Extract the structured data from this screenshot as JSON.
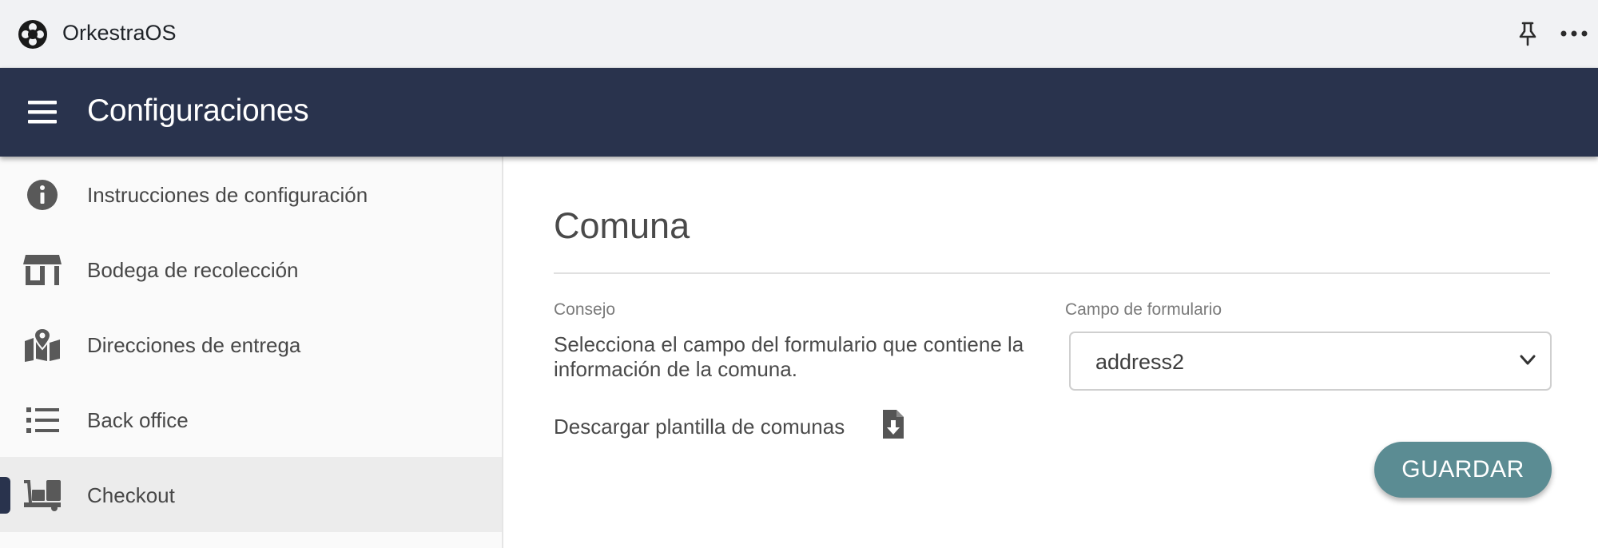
{
  "titlebar": {
    "app_name": "OrkestraOS"
  },
  "header": {
    "title": "Configuraciones"
  },
  "sidebar": {
    "items": [
      {
        "label": "Instrucciones de configuración",
        "icon": "info-icon",
        "active": false
      },
      {
        "label": "Bodega de recolección",
        "icon": "store-icon",
        "active": false
      },
      {
        "label": "Direcciones de entrega",
        "icon": "map-pin-icon",
        "active": false
      },
      {
        "label": "Back office",
        "icon": "list-icon",
        "active": false
      },
      {
        "label": "Checkout",
        "icon": "dolly-icon",
        "active": true
      }
    ]
  },
  "main": {
    "section_title": "Comuna",
    "hint_label": "Consejo",
    "hint_text": "Selecciona el campo del formulario que contiene la información de la comuna.",
    "form_field_label": "Campo de formulario",
    "form_field_value": "address2",
    "download_label": "Descargar plantilla de comunas",
    "download_icon": "file-download-icon",
    "save_label": "GUARDAR"
  },
  "colors": {
    "header_bg": "#29334d",
    "save_button": "#5b8c93",
    "sidebar_active": "#ececec"
  }
}
